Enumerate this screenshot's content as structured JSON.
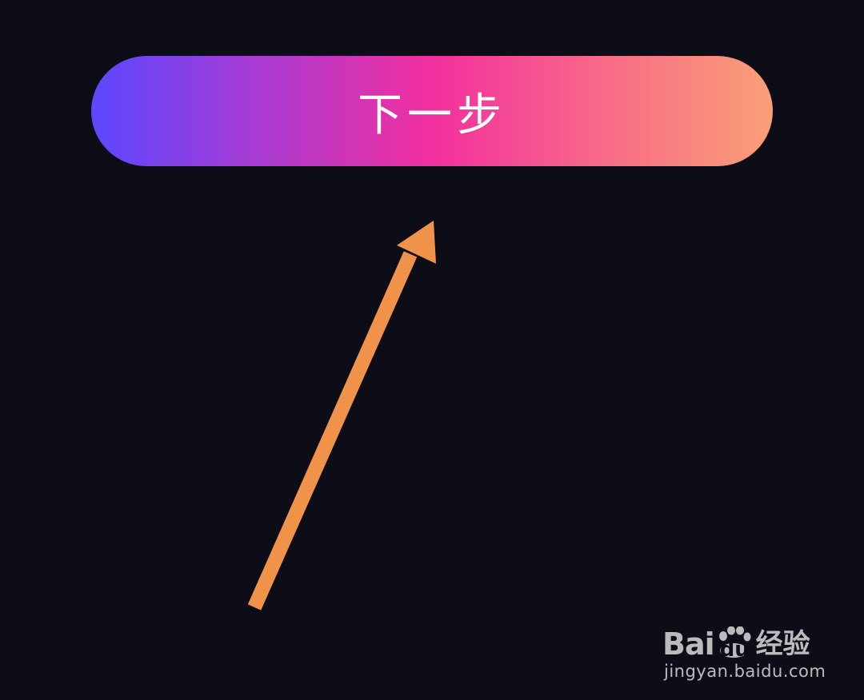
{
  "screen": {
    "background_color": "#0d0d17"
  },
  "next_button": {
    "label": "下一步",
    "gradient_colors": [
      "#5b48ff",
      "#a83bd4",
      "#f22f9e",
      "#f86a87",
      "#f99f76"
    ],
    "text_color": "#ffffff"
  },
  "annotation_arrow": {
    "icon": "arrow-up-right-icon",
    "color": "#f0924a"
  },
  "watermark": {
    "brand_left": "Bai",
    "brand_paw": "du",
    "brand_right": "经验",
    "url": "jingyan.baidu.com"
  }
}
